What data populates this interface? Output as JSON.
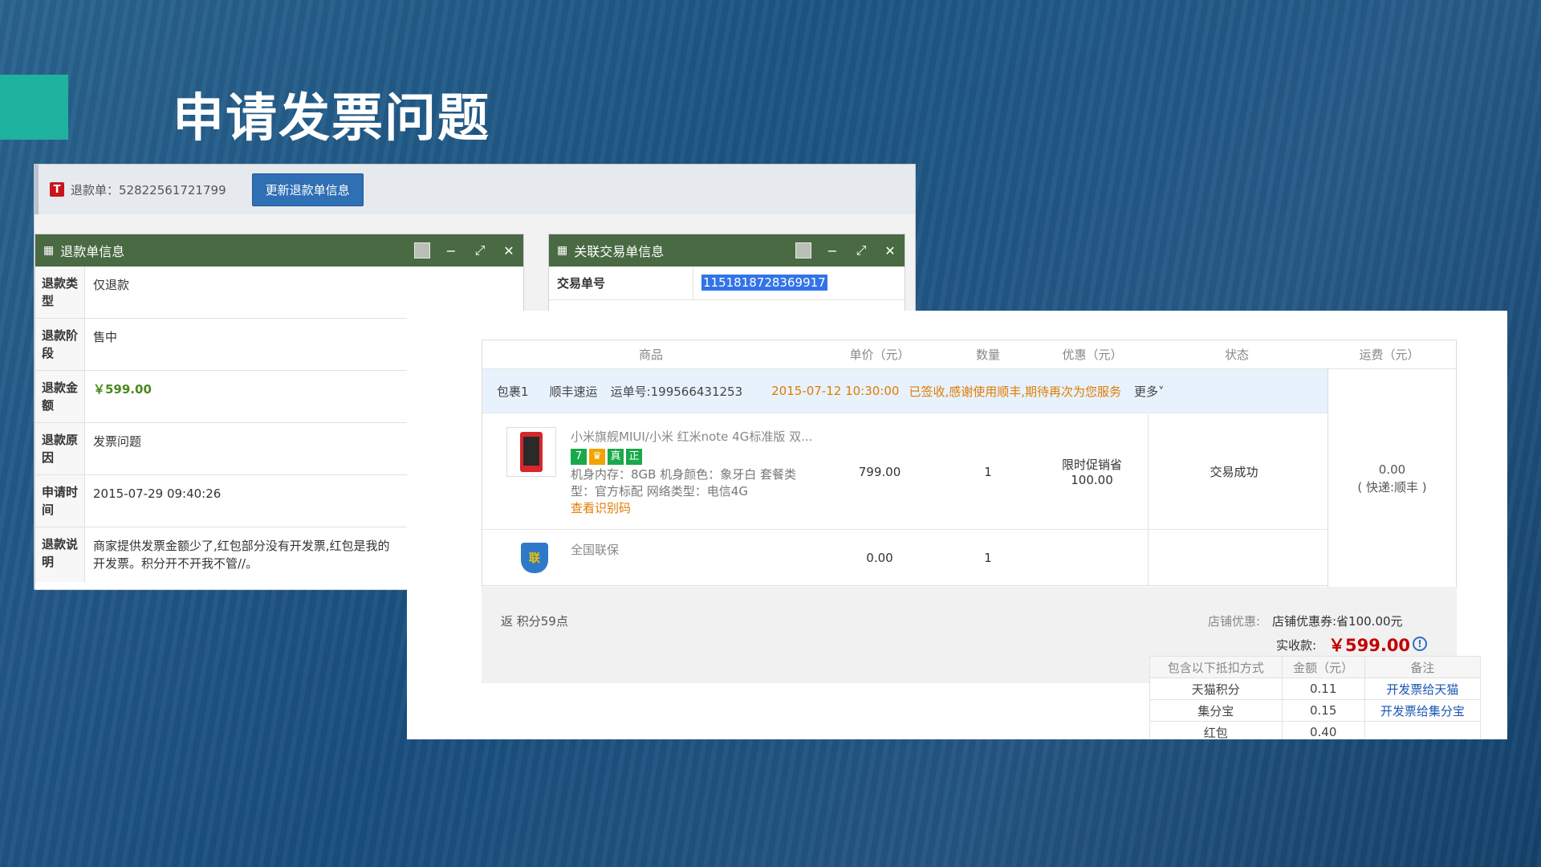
{
  "slide": {
    "title": "申请发票问题"
  },
  "refund_shot": {
    "refund_no_label": "退款单：52822561721799",
    "update_button": "更新退款单信息",
    "logo_letter": "T",
    "refund_panel_title": "退款单信息",
    "trade_panel_title": "关联交易单信息",
    "trade_no_label": "交易单号",
    "trade_no_value": "1151818728369917",
    "rows": [
      {
        "key": "退款类型",
        "value": "仅退款"
      },
      {
        "key": "退款阶段",
        "value": "售中"
      },
      {
        "key": "退款金额",
        "value": "￥599.00"
      },
      {
        "key": "退款原因",
        "value": "发票问题"
      },
      {
        "key": "申请时间",
        "value": "2015-07-29 09:40:26"
      },
      {
        "key": "退款说明",
        "value": "商家提供发票金额少了,红包部分没有开发票,红包是我的开发票。积分开不开我不管//。"
      }
    ]
  },
  "order_shot": {
    "columns": [
      "商品",
      "单价（元）",
      "数量",
      "优惠（元）",
      "状态",
      "运费（元）"
    ],
    "package": {
      "name": "包裹1",
      "carrier": "顺丰速运",
      "tracking": "运单号:199566431253",
      "time": "2015-07-12 10:30:00",
      "status": "已签收,感谢使用顺丰,期待再次为您服务",
      "more": "更多˅"
    },
    "item": {
      "title": "小米旗舰MIUI/小米 红米note 4G标准版 双...",
      "tags": [
        "7",
        "♛",
        "真",
        "正"
      ],
      "specs_line1": "机身内存：8GB 机身颜色：象牙白 套餐类",
      "specs_line2": "型：官方标配 网络类型：电信4G",
      "link": "查看识别码",
      "price": "799.00",
      "qty": "1",
      "discount_label": "限时促销省",
      "discount_value": "100.00",
      "status": "交易成功"
    },
    "service": {
      "name": "全国联保",
      "icon_char": "联",
      "price": "0.00",
      "qty": "1"
    },
    "shipping": {
      "fee": "0.00",
      "method": "( 快递:顺丰 )"
    },
    "points": "返 积分59点",
    "shop_discount_label": "店铺优惠:",
    "shop_discount_value": "店铺优惠券:省100.00元",
    "paid_label": "实收款:",
    "paid_value": "￥599.00",
    "deduct": {
      "headers": [
        "包含以下抵扣方式",
        "金额（元）",
        "备注"
      ],
      "rows": [
        {
          "method": "天猫积分",
          "amount": "0.11",
          "note": "开发票给天猫"
        },
        {
          "method": "集分宝",
          "amount": "0.15",
          "note": "开发票给集分宝"
        },
        {
          "method": "红包",
          "amount": "0.40",
          "note": ""
        }
      ]
    }
  }
}
